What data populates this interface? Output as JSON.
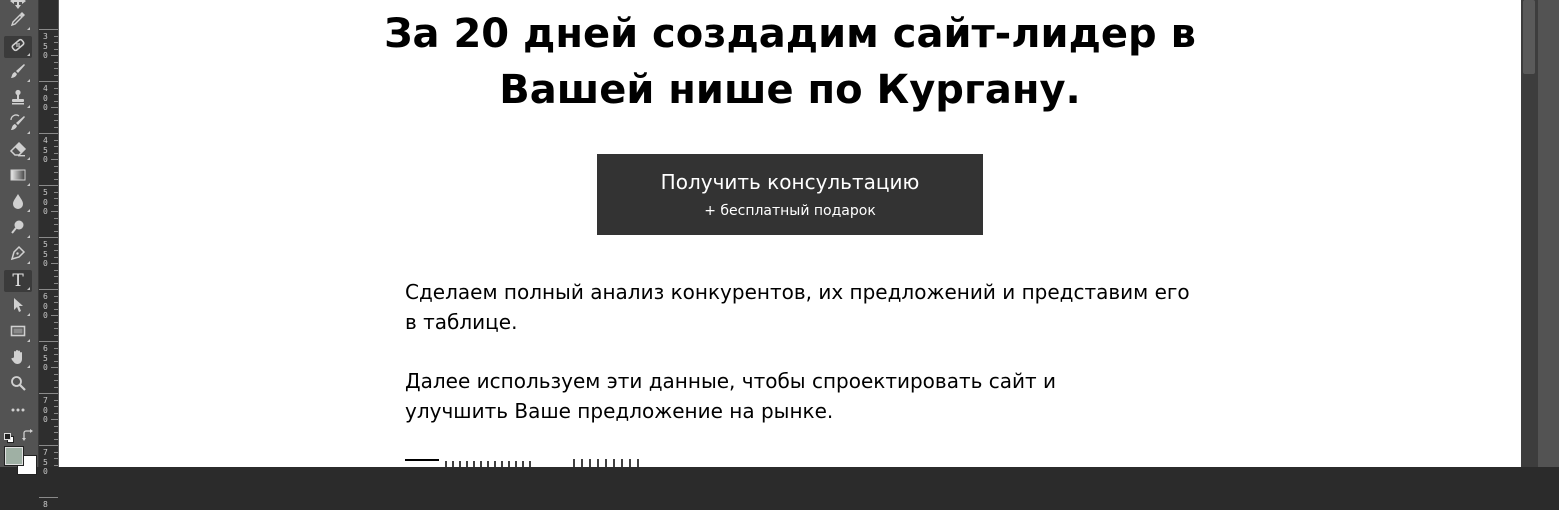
{
  "tools": [
    {
      "icon": "move-icon"
    },
    {
      "icon": "eyedropper-icon"
    },
    {
      "icon": "healing-brush-icon",
      "active": true
    },
    {
      "icon": "brush-icon"
    },
    {
      "icon": "clone-stamp-icon"
    },
    {
      "icon": "history-brush-icon"
    },
    {
      "icon": "eraser-icon"
    },
    {
      "icon": "gradient-icon"
    },
    {
      "icon": "blur-icon"
    },
    {
      "icon": "dodge-icon"
    },
    {
      "icon": "pen-icon"
    },
    {
      "icon": "type-icon",
      "glyph": "T",
      "active": true
    },
    {
      "icon": "path-selection-icon"
    },
    {
      "icon": "rectangle-icon"
    },
    {
      "icon": "hand-icon"
    },
    {
      "icon": "zoom-icon"
    },
    {
      "icon": "more-tools-icon",
      "glyph": "..."
    }
  ],
  "colors": {
    "foreground": "#9fb0a4",
    "background": "#ffffff"
  },
  "ruler": {
    "labels": [
      "350",
      "400",
      "450",
      "500",
      "550",
      "600",
      "650",
      "700",
      "750",
      "8"
    ]
  },
  "page": {
    "headline_line1": "За 20 дней создадим сайт-лидер в",
    "headline_line2": "Вашей нише по Кургану.",
    "cta_main": "Получить консультацию",
    "cta_sub": "+ бесплатный подарок",
    "paragraph1_line1": "Сделаем полный анализ конкурентов, их предложений и представим его",
    "paragraph1_line2": "в таблице.",
    "paragraph2_line1": "Далее используем эти данные, чтобы спроектировать сайт и",
    "paragraph2_line2": "улучшить Ваше предложение на рынке."
  }
}
